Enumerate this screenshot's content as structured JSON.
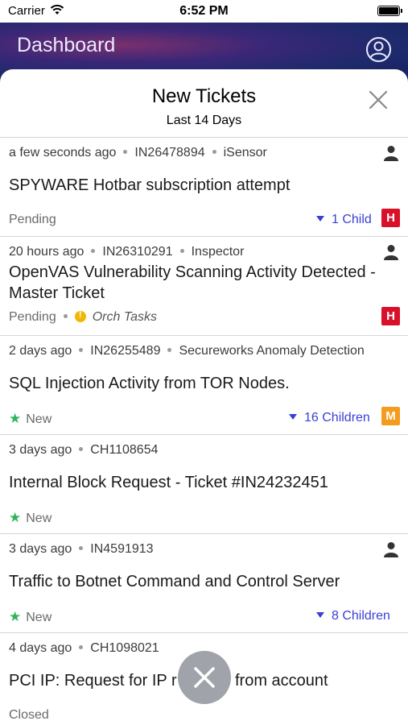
{
  "status_bar": {
    "carrier": "Carrier",
    "time": "6:52 PM"
  },
  "header": {
    "title": "Dashboard"
  },
  "sheet": {
    "title": "New Tickets",
    "subtitle": "Last 14 Days"
  },
  "tickets": [
    {
      "time": "a few seconds ago",
      "id": "IN26478894",
      "source": "iSensor",
      "title_line1": "SPYWARE Hotbar subscription attempt",
      "title_line2": "",
      "status": "Pending",
      "extra": "",
      "children": "1 Child",
      "badge": "H"
    },
    {
      "time": "20 hours ago",
      "id": "IN26310291",
      "source": "Inspector",
      "title_line1": "OpenVAS Vulnerability Scanning Activity Detected -",
      "title_line2": "Master Ticket",
      "status": "Pending",
      "extra": "Orch Tasks",
      "children": "",
      "badge": "H"
    },
    {
      "time": "2 days ago",
      "id": "IN26255489",
      "source": "Secureworks Anomaly Detection",
      "title_line1": "SQL Injection Activity from TOR Nodes.",
      "title_line2": "",
      "status": "New",
      "extra": "",
      "children": "16 Children",
      "badge": "M"
    },
    {
      "time": "3 days ago",
      "id": "CH1108654",
      "source": "",
      "title_line1": "Internal Block Request - Ticket #IN24232451",
      "title_line2": "",
      "status": "New",
      "extra": "",
      "children": "",
      "badge": ""
    },
    {
      "time": "3 days ago",
      "id": "IN4591913",
      "source": "",
      "title_line1": "Traffic to Botnet Command and Control Server",
      "title_line2": "",
      "status": "New",
      "extra": "",
      "children": "8 Children",
      "badge": ""
    },
    {
      "time": "4 days ago",
      "id": "CH1098021",
      "source": "",
      "title_line1": "PCI IP: Request for IP r",
      "title_line1_tail": "from account",
      "title_line2": "",
      "status": "Closed",
      "extra": "",
      "children": "",
      "badge": ""
    }
  ],
  "colors": {
    "accent": "#3a40d6",
    "high": "#d8102a",
    "medium": "#f39c1e",
    "new_star": "#2fb45a",
    "header_bg": "#1d2a6b"
  },
  "icons": {
    "wifi": "wifi-icon",
    "battery": "battery-icon",
    "profile": "profile-icon",
    "close": "close-icon",
    "person": "person-icon",
    "fab": "close-fab-icon"
  }
}
